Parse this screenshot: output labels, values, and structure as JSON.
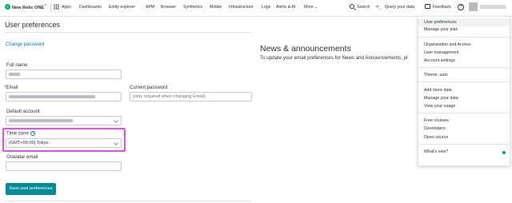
{
  "nav": {
    "brand": "New Relic ONE",
    "brand_tm": "™",
    "items": [
      "Apps",
      "Dashboards",
      "Entity explorer",
      "APM",
      "Browser",
      "Synthetics",
      "Mobile",
      "Infrastructure",
      "Logs",
      "Alerts & AI",
      "More ⌄"
    ],
    "search": "Search",
    "query": "Query your data",
    "feedback": "Feedback",
    "help": "?"
  },
  "page": {
    "title": "User preferences",
    "change_password": "Change password",
    "full_name_label": "Full name",
    "email_label": "Email",
    "email_required": "*",
    "current_password_label": "Current password",
    "current_password_placeholder": "(only required when changing Email)",
    "default_account_label": "Default account",
    "time_zone_label": "Time zone",
    "time_zone_help": "?",
    "time_zone_value": "(GMT+09:00) Tokyo",
    "gravatar_label": "Gravatar email",
    "save_button": "Save user preferences"
  },
  "news": {
    "title": "News & announcements",
    "text": "To update your email preferences for News and Announcements, pl"
  },
  "menu": {
    "items": {
      "user_preferences": "User preferences",
      "manage_plan": "Manage your plan",
      "org_access": "Organization and Access",
      "user_management": "User management",
      "account_settings": "Account settings",
      "theme": "Theme: auto",
      "add_data": "Add more data",
      "manage_data": "Manage your data",
      "view_usage": "View your usage",
      "free_courses": "Free courses",
      "developers": "Developers",
      "open_source": "Open source",
      "whats_new": "What's new?"
    }
  },
  "colors": {
    "accent": "#008c99",
    "link": "#0078bf",
    "highlight": "#ea4af0",
    "required": "#df2d24"
  }
}
